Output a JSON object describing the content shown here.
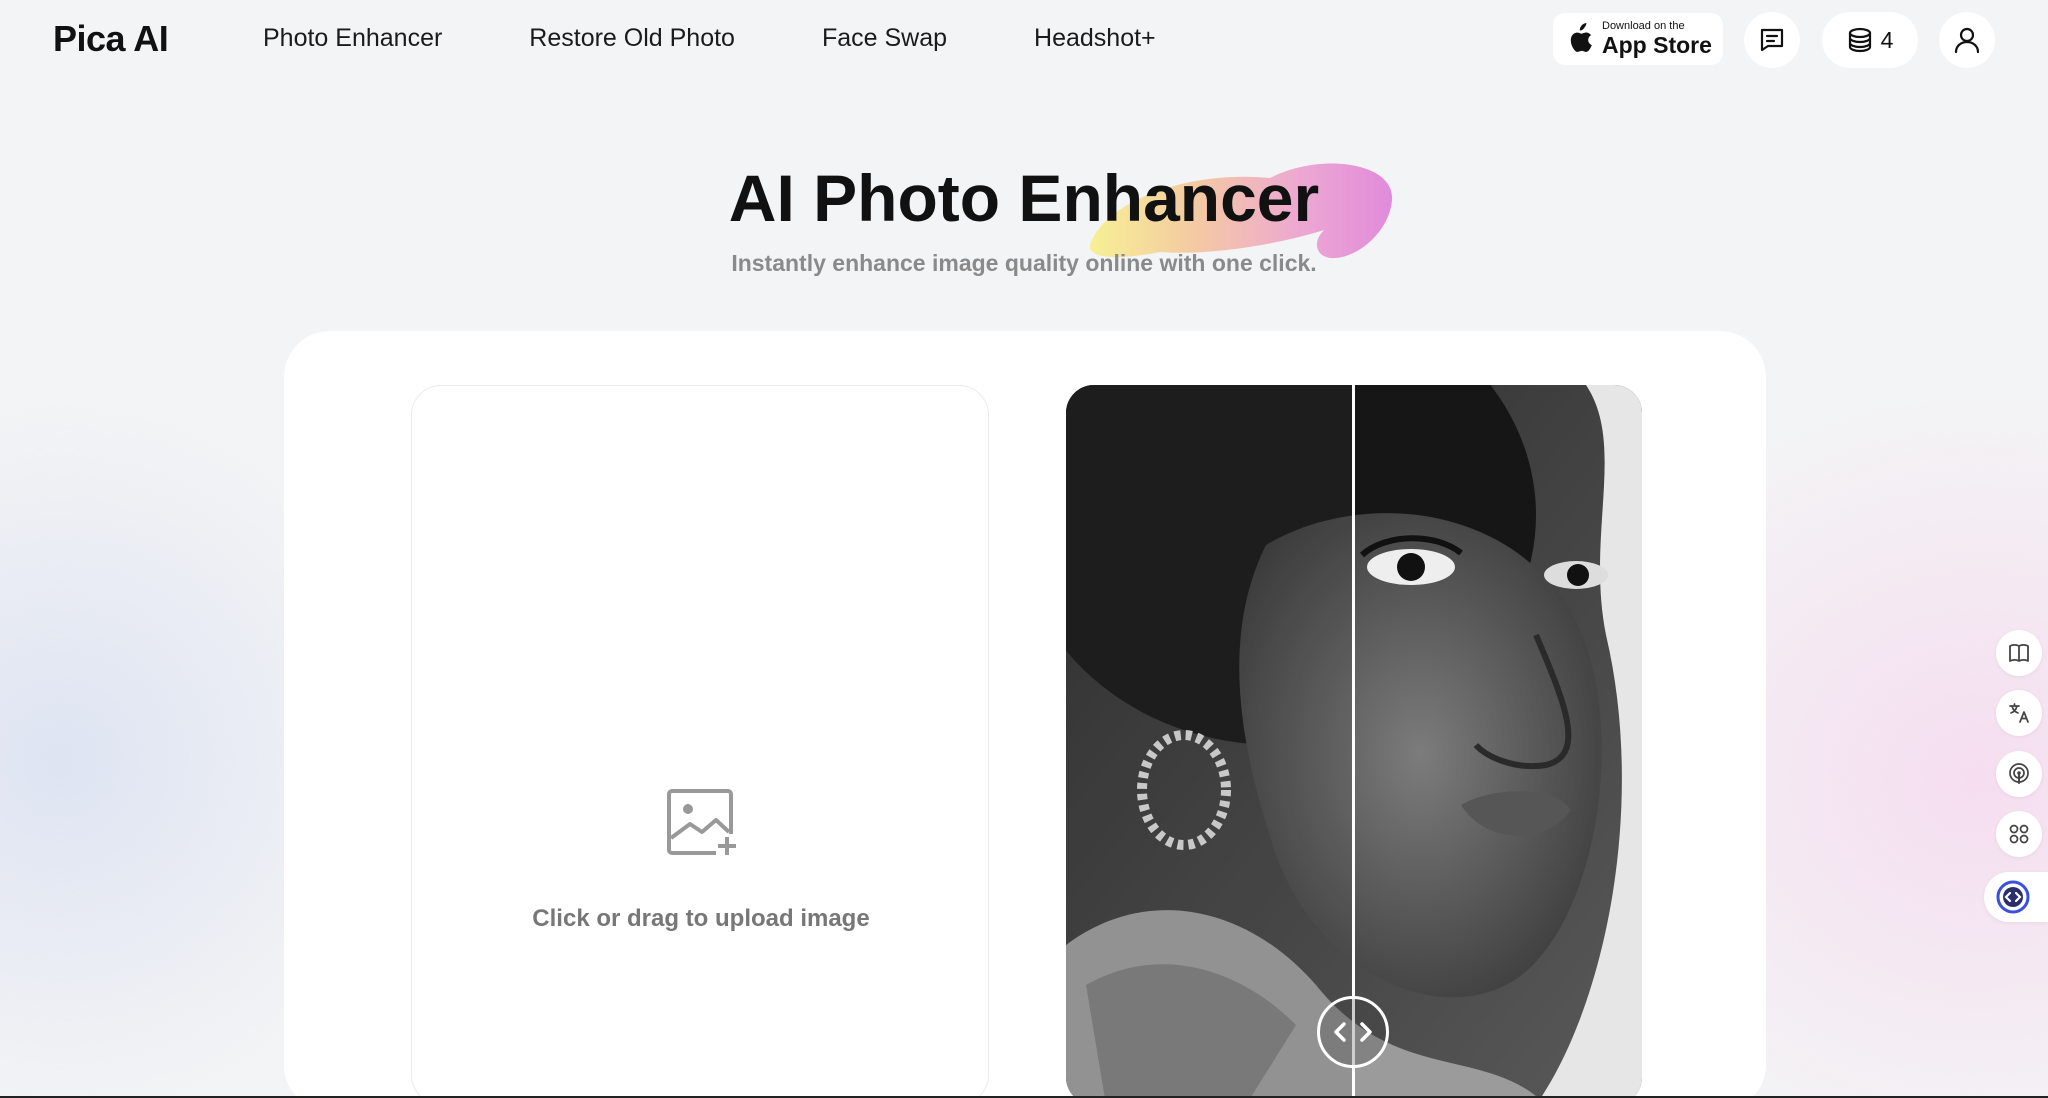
{
  "header": {
    "logo": "Pica AI",
    "nav": [
      "Photo Enhancer",
      "Restore Old Photo",
      "Face Swap",
      "Headshot+"
    ],
    "appstore_small": "Download on the",
    "appstore_big": "App Store",
    "credits": "4",
    "icons": [
      "message-icon",
      "coins-icon",
      "user-icon"
    ]
  },
  "hero": {
    "title": "AI Photo Enhancer",
    "subtitle": "Instantly enhance image quality online with one click."
  },
  "upload": {
    "label": "Click or drag to upload image",
    "icon": "image-add-icon"
  },
  "compare": {
    "icon": "compare-arrows-icon"
  },
  "sidebar": {
    "icons": [
      "book-icon",
      "translate-icon",
      "podcast-icon",
      "apps-icon",
      "chat-bot-icon"
    ]
  },
  "colors": {
    "background": "#f3f4f5",
    "card": "#ffffff",
    "subtitle": "#8a8a8a",
    "accent_pink": "#e48bd8",
    "accent_yellow": "#f6ec8a"
  }
}
